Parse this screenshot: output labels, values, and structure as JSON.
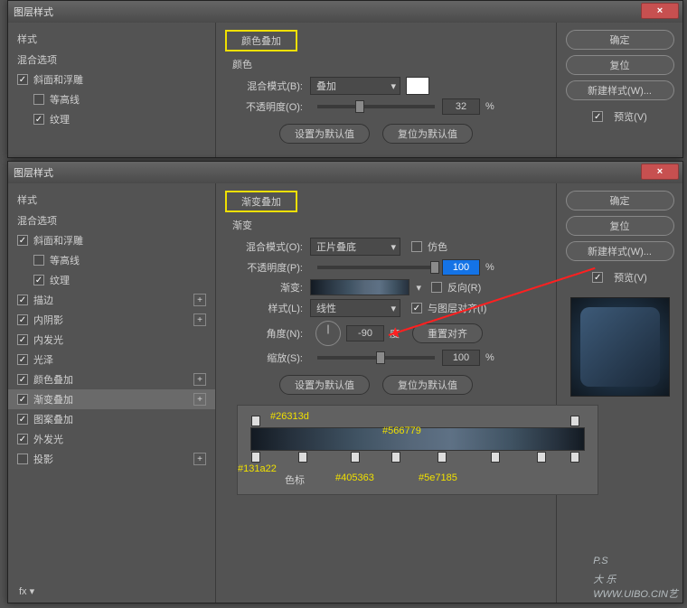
{
  "dialog1": {
    "title": "图层样式",
    "section_title": "颜色叠加",
    "sub_title": "颜色",
    "sidebar": {
      "head": "样式",
      "blend_options": "混合选项",
      "items": [
        {
          "label": "斜面和浮雕",
          "checked": true
        },
        {
          "label": "等高线",
          "checked": false,
          "indent": true
        },
        {
          "label": "纹理",
          "checked": true,
          "indent": true
        }
      ]
    },
    "blend_mode_label": "混合模式(B):",
    "blend_mode_value": "叠加",
    "opacity_label": "不透明度(O):",
    "opacity_value": "32",
    "pct": "%",
    "btn_default": "设置为默认值",
    "btn_reset": "复位为默认值",
    "right": {
      "ok": "确定",
      "reset": "复位",
      "new_style": "新建样式(W)...",
      "preview": "预览(V)"
    }
  },
  "dialog2": {
    "title": "图层样式",
    "section_title": "渐变叠加",
    "sub_title": "渐变",
    "sidebar": {
      "head": "样式",
      "blend_options": "混合选项",
      "items": [
        {
          "label": "斜面和浮雕",
          "checked": true
        },
        {
          "label": "等高线",
          "checked": false,
          "indent": true
        },
        {
          "label": "纹理",
          "checked": true,
          "indent": true
        },
        {
          "label": "描边",
          "checked": true,
          "plus": true
        },
        {
          "label": "内阴影",
          "checked": true,
          "plus": true
        },
        {
          "label": "内发光",
          "checked": true
        },
        {
          "label": "光泽",
          "checked": true
        },
        {
          "label": "颜色叠加",
          "checked": true,
          "plus": true
        },
        {
          "label": "渐变叠加",
          "checked": true,
          "plus": true,
          "sel": true
        },
        {
          "label": "图案叠加",
          "checked": true
        },
        {
          "label": "外发光",
          "checked": true
        },
        {
          "label": "投影",
          "checked": false,
          "plus": true
        }
      ],
      "fx": "fx"
    },
    "blend_mode_label": "混合模式(O):",
    "blend_mode_value": "正片叠底",
    "dither_label": "仿色",
    "opacity_label": "不透明度(P):",
    "opacity_value": "100",
    "grad_label": "渐变:",
    "reverse_label": "反向(R)",
    "style_label": "样式(L):",
    "style_value": "线性",
    "align_label": "与图层对齐(I)",
    "angle_label": "角度(N):",
    "angle_value": "-90",
    "angle_unit": "度",
    "reset_align": "重置对齐",
    "scale_label": "缩放(S):",
    "scale_value": "100",
    "pct": "%",
    "btn_default": "设置为默认值",
    "btn_reset": "复位为默认值",
    "right": {
      "ok": "确定",
      "reset": "复位",
      "new_style": "新建样式(W)...",
      "preview": "预览(V)"
    },
    "gradient_editor": {
      "stop_label": "色标",
      "colors": [
        "#131a22",
        "#26313d",
        "#405363",
        "#566779",
        "#5e7185"
      ]
    }
  },
  "watermark": {
    "big": "P.S",
    "small1": "大 乐",
    "small2": "WWW.UIBO.CIN艺"
  }
}
